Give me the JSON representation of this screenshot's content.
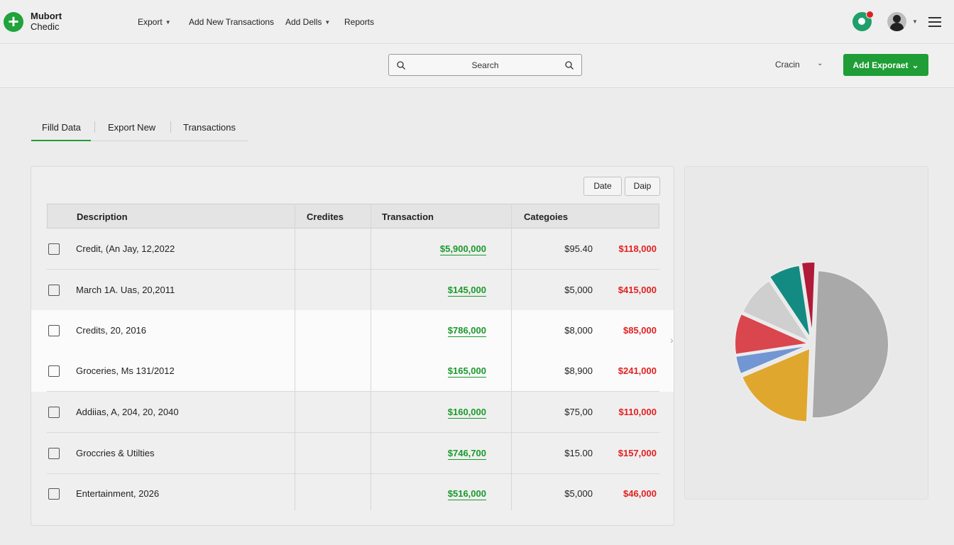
{
  "brand": {
    "line1": "Mubort",
    "line2": "Chedic"
  },
  "nav": [
    {
      "label": "Export",
      "caret": true
    },
    {
      "label": "Add New Transactions",
      "caret": false
    },
    {
      "label": "Add Dells",
      "caret": true
    },
    {
      "label": "Reports",
      "caret": false
    }
  ],
  "search": {
    "placeholder": "Search"
  },
  "account_dropdown": {
    "value": "Cracin"
  },
  "add_button": {
    "label": "Add Exporaet"
  },
  "tabs": [
    {
      "label": "Filld Data",
      "active": true
    },
    {
      "label": "Export New",
      "active": false
    },
    {
      "label": "Transactions",
      "active": false
    }
  ],
  "table": {
    "buttons": {
      "date": "Date",
      "daip": "Daip"
    },
    "headers": [
      "Description",
      "Credites",
      "Transaction",
      "Categoies"
    ],
    "rows": [
      {
        "description": "Credit, (An Jay, 12,2022",
        "transaction": "$5,900,000",
        "value": "$95.40",
        "amount": "$118,000",
        "highlight": false
      },
      {
        "description": "March 1A. Uas, 20,2011",
        "transaction": "$145,000",
        "value": "$5,000",
        "amount": "$415,000",
        "highlight": false
      },
      {
        "description": "Credits, 20, 2016",
        "transaction": "$786,000",
        "value": "$8,000",
        "amount": "$85,000",
        "highlight": true
      },
      {
        "description": "Groceries, Ms 131/2012",
        "transaction": "$165,000",
        "value": "$8,900",
        "amount": "$241,000",
        "highlight": true
      },
      {
        "description": "Addiias, A, 204, 20, 2040",
        "transaction": "$160,000",
        "value": "$75,00",
        "amount": "$110,000",
        "highlight": false
      },
      {
        "description": "Groccries & Utilties",
        "transaction": "$746,700",
        "value": "$15.00",
        "amount": "$157,000",
        "highlight": false
      },
      {
        "description": "Entertainment, 2026",
        "transaction": "$516,000",
        "value": "$5,000",
        "amount": "$46,000",
        "highlight": false
      }
    ]
  },
  "colors": {
    "accent_green": "#1f9d36",
    "positive": "#1a9a2c",
    "negative": "#e32020"
  },
  "chart_data": {
    "type": "pie",
    "title": "",
    "slices": [
      {
        "value": 50,
        "color": "#a9a9a9"
      },
      {
        "value": 18,
        "color": "#e0a72e"
      },
      {
        "value": 4,
        "color": "#7296d4"
      },
      {
        "value": 9,
        "color": "#d9464e"
      },
      {
        "value": 9,
        "color": "#cfcfcf"
      },
      {
        "value": 7,
        "color": "#138b82"
      },
      {
        "value": 3,
        "color": "#b01b3a"
      }
    ]
  }
}
